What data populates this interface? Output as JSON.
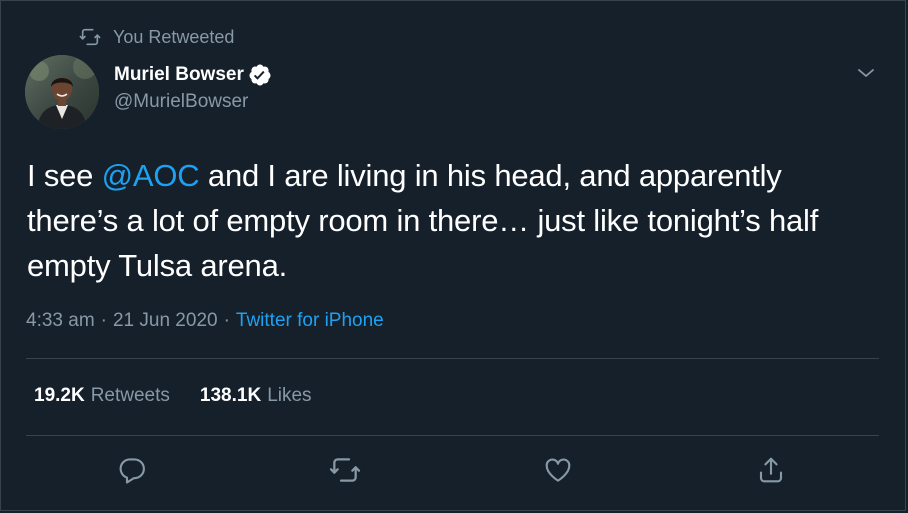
{
  "context": {
    "label": "You Retweeted",
    "icon": "retweet-icon"
  },
  "author": {
    "display_name": "Muriel Bowser",
    "handle": "@MurielBowser",
    "verified_icon": "verified-badge-icon"
  },
  "tweet": {
    "text_before": "I see ",
    "mention": "@AOC",
    "text_after": " and I are living in his head, and apparently there’s a lot of empty room in there… just like tonight’s half empty Tulsa arena."
  },
  "meta": {
    "time": "4:33 am",
    "separator": "·",
    "date": "21 Jun 2020",
    "source": "Twitter for iPhone"
  },
  "stats": {
    "retweets_count": "19.2K",
    "retweets_label": "Retweets",
    "likes_count": "138.1K",
    "likes_label": "Likes"
  },
  "actions": [
    "reply-icon",
    "retweet-icon",
    "like-icon",
    "share-icon"
  ],
  "colors": {
    "background": "#15202b",
    "text": "#ffffff",
    "muted": "#8899a6",
    "accent": "#1da1f2",
    "border": "#38444d"
  }
}
